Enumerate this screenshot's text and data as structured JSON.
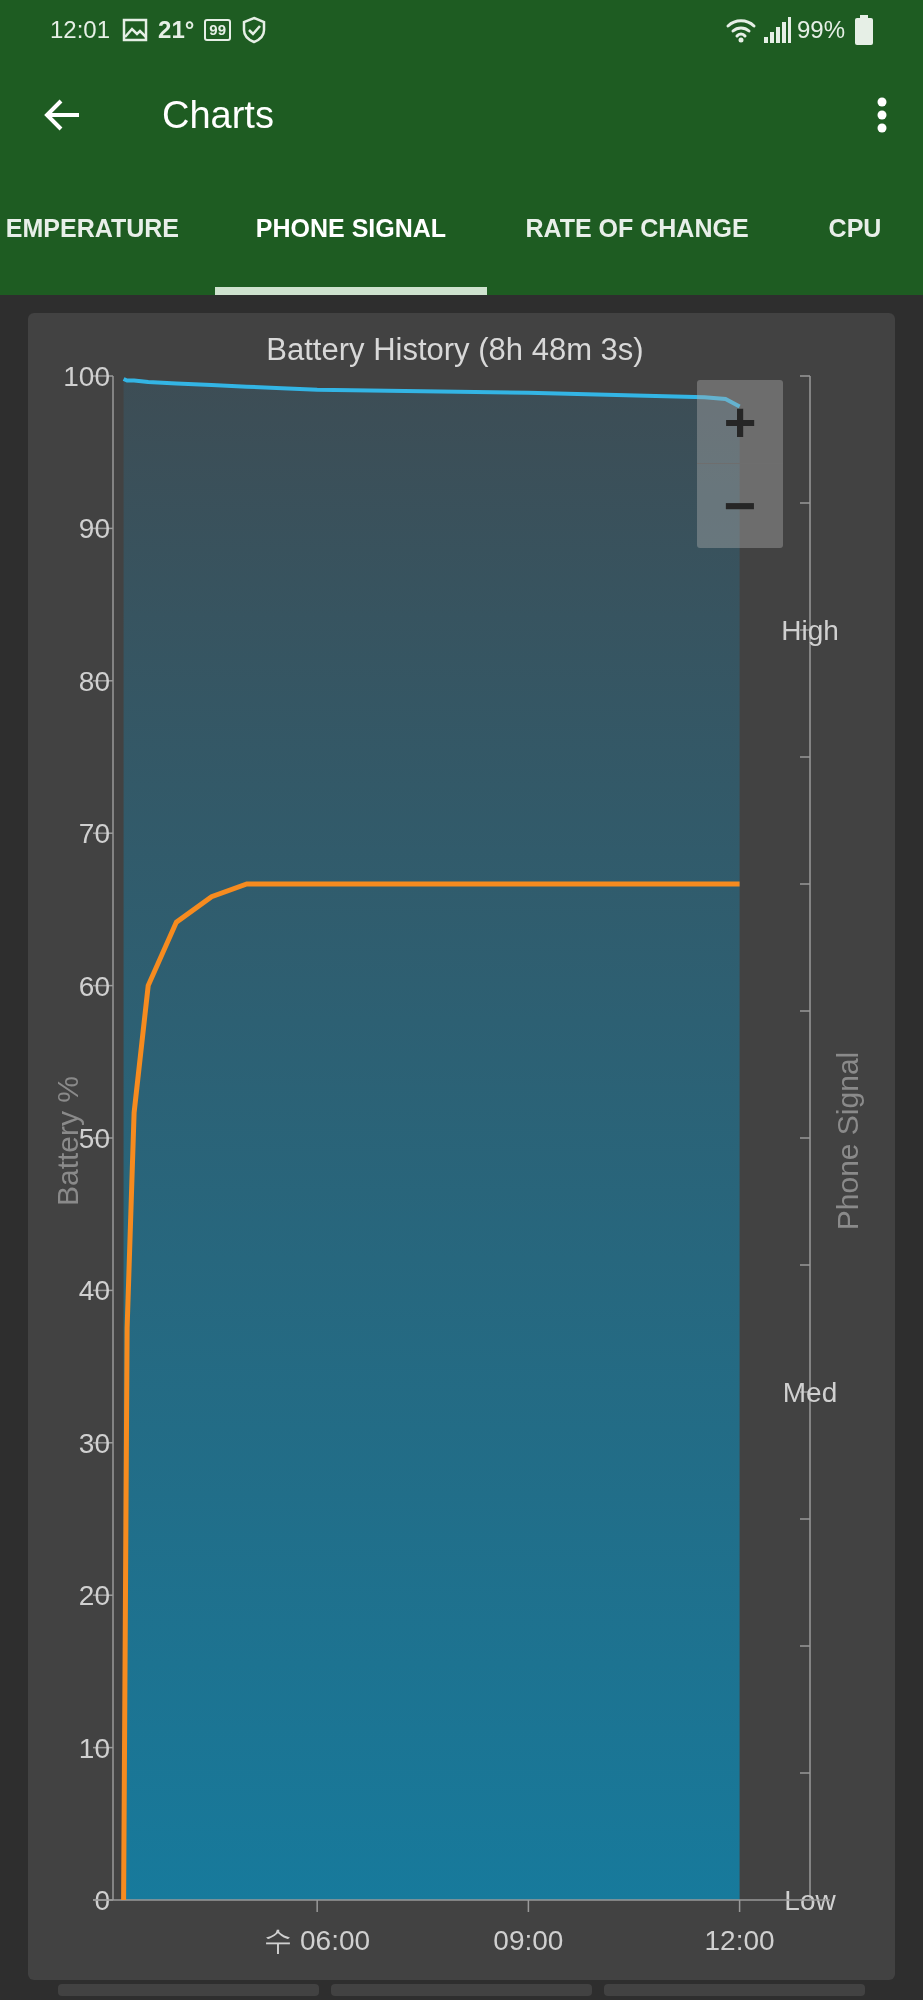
{
  "status_bar": {
    "time": "12:01",
    "temperature": "21°",
    "badge": "99",
    "battery_percent": "99%"
  },
  "app_bar": {
    "title": "Charts"
  },
  "tabs": [
    {
      "label": "EMPERATURE",
      "selected": false
    },
    {
      "label": "PHONE SIGNAL",
      "selected": true
    },
    {
      "label": "RATE OF CHANGE",
      "selected": false
    },
    {
      "label": "CPU",
      "selected": false
    }
  ],
  "zoom_controls": [
    "+",
    "−"
  ],
  "chart_data": {
    "type": "area",
    "title": "Battery History (8h 48m 3s)",
    "ylabel": "Battery %",
    "y2label": "Phone Signal",
    "xlim": [
      3.1,
      13.0
    ],
    "ylim": [
      0,
      100
    ],
    "xticks": [
      {
        "value": 6,
        "label": "수 06:00"
      },
      {
        "value": 9,
        "label": "09:00"
      },
      {
        "value": 12,
        "label": "12:00"
      }
    ],
    "yticks": [
      0,
      10,
      20,
      30,
      40,
      50,
      60,
      70,
      80,
      90,
      100
    ],
    "y2ticks": [
      "Low",
      null,
      null,
      null,
      "Med",
      null,
      null,
      null,
      null,
      null,
      "High",
      null,
      null
    ],
    "x": [
      3.25,
      3.3,
      3.4,
      3.6,
      4,
      4.5,
      5,
      5.5,
      6,
      9,
      11.5,
      11.8,
      12
    ],
    "series": [
      {
        "color": "#33b5e5",
        "type": "area",
        "values": [
          99.8,
          99.7,
          99.7,
          99.6,
          99.5,
          99.4,
          99.3,
          99.2,
          99.1,
          98.9,
          98.6,
          98.5,
          98.0
        ]
      }
    ]
  }
}
